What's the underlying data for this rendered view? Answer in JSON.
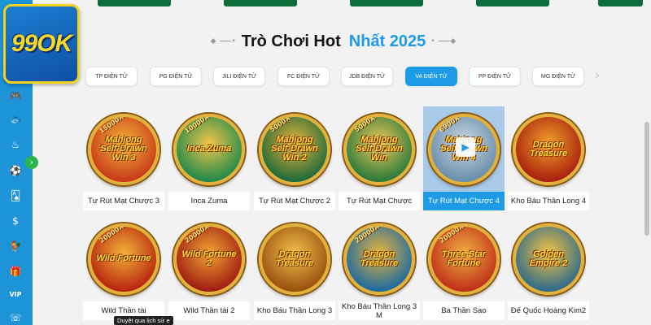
{
  "brand": {
    "logo_text": "99OK"
  },
  "section": {
    "title_main": "Trò Chơi Hot",
    "title_accent": "Nhất 2025"
  },
  "tabs": [
    {
      "label": "TP ĐIỆN TỬ",
      "active": false
    },
    {
      "label": "PG ĐIỆN TỬ",
      "active": false
    },
    {
      "label": "JILI ĐIỆN TỬ",
      "active": false
    },
    {
      "label": "FC ĐIỆN TỬ",
      "active": false
    },
    {
      "label": "JDB ĐIỆN TỬ",
      "active": false
    },
    {
      "label": "VA ĐIỆN TỬ",
      "active": true
    },
    {
      "label": "PP ĐIỆN TỬ",
      "active": false
    },
    {
      "label": "MG ĐIỆN TỬ",
      "active": false
    }
  ],
  "sidebar_icons": [
    "gamepad-icon",
    "fish-icon",
    "lottery-icon",
    "soccer-icon",
    "cards-icon",
    "coin-icon",
    "rooster-icon",
    "gift-icon",
    "vip-icon",
    "phone-icon"
  ],
  "games": [
    {
      "name": "Tự Rút Mạt Chược 3",
      "art_text": "Mahjong Self-Drawn Win 3",
      "multiplier": "15000X",
      "colors": [
        "#c83a1a",
        "#f2b53a"
      ]
    },
    {
      "name": "Inca Zuma",
      "art_text": "Inca Zuma",
      "multiplier": "10000X",
      "colors": [
        "#1f8a4a",
        "#f3c44a"
      ]
    },
    {
      "name": "Tự Rút Mạt Chược 2",
      "art_text": "Mahjong Self-Drawn Win 2",
      "multiplier": "5000X",
      "colors": [
        "#1e6b3a",
        "#e9b23c"
      ]
    },
    {
      "name": "Tự Rút Mạt Chược",
      "art_text": "Mahjong Self-Drawn Win",
      "multiplier": "5000X",
      "colors": [
        "#2a7a3a",
        "#f0c85a"
      ]
    },
    {
      "name": "Tự Rút Mạt Chược 4",
      "art_text": "Mahjong Self-Drawn Win 4",
      "multiplier": "6900X",
      "colors": [
        "#6a8eaa",
        "#c9d8e4"
      ],
      "highlight": true
    },
    {
      "name": "Kho Báu Thần Long 4",
      "art_text": "Dragon Treasure",
      "multiplier": "",
      "colors": [
        "#a8200e",
        "#f0a02a"
      ]
    },
    {
      "name": "Wild Thần tài",
      "art_text": "Wild Fortune",
      "multiplier": "20000X",
      "colors": [
        "#b8250f",
        "#f3b23a"
      ]
    },
    {
      "name": "Wild Thần tài 2",
      "art_text": "Wild Fortune 2",
      "multiplier": "20000X",
      "colors": [
        "#a11c12",
        "#efa532"
      ]
    },
    {
      "name": "Kho Báu Thần Long 3",
      "art_text": "Dragon Treasure",
      "multiplier": "",
      "colors": [
        "#9a5010",
        "#f2c04a"
      ]
    },
    {
      "name": "Kho Báu Thần Long 3 M",
      "art_text": "Dragon Treasure",
      "multiplier": "20000X",
      "colors": [
        "#1c6aa0",
        "#e9b43e"
      ]
    },
    {
      "name": "Ba Thần Sao",
      "art_text": "Three Star Fortune",
      "multiplier": "20000X",
      "colors": [
        "#c0301a",
        "#f0b040"
      ]
    },
    {
      "name": "Đế Quốc Hoàng Kim2",
      "art_text": "Golden Empire 2",
      "multiplier": "",
      "colors": [
        "#2f6a8a",
        "#f2c444"
      ]
    }
  ],
  "tooltip": "Duyệt qua lịch sử e"
}
